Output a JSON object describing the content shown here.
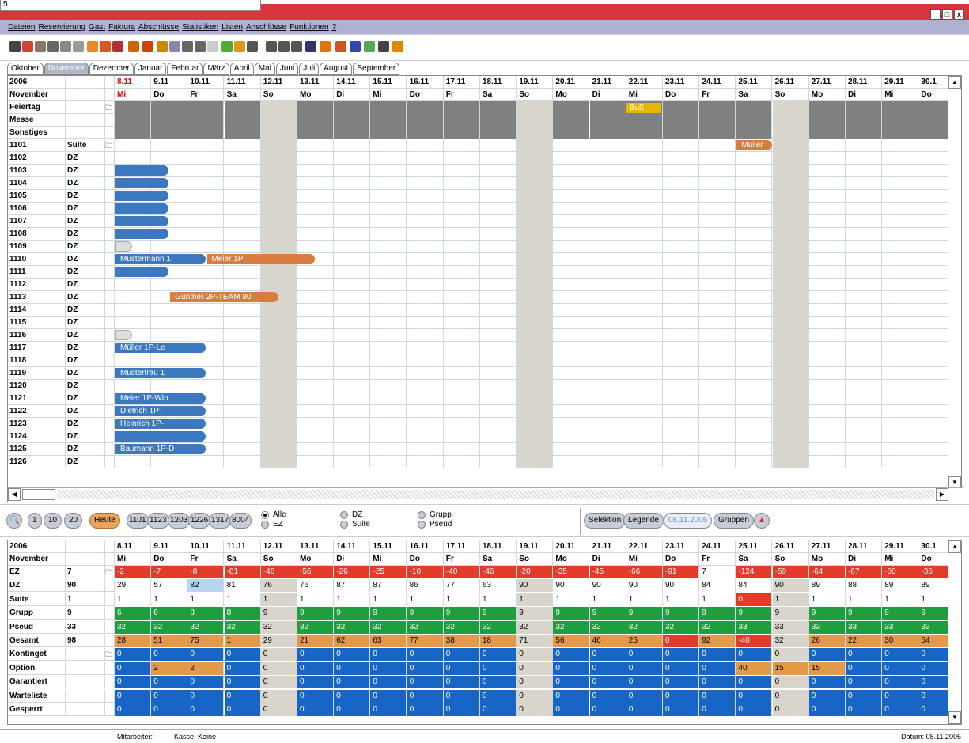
{
  "tooltip": "5",
  "menu": [
    "Dateien",
    "Reservierung",
    "Gast",
    "Faktura",
    "Abschlüsse",
    "Statistiken",
    "Listen",
    "Anschlüsse",
    "Funktionen",
    "?"
  ],
  "window_buttons": [
    "_",
    "□",
    "x"
  ],
  "tabs": [
    "Oktober",
    "November",
    "Dezember",
    "Januar",
    "Februar",
    "März",
    "April",
    "Mai",
    "Juni",
    "Juli",
    "August",
    "September"
  ],
  "active_tab": 1,
  "year": "2006",
  "month": "November",
  "dates": [
    "8.11",
    "9.11",
    "10.11",
    "11.11",
    "12.11",
    "13.11",
    "14.11",
    "15.11",
    "16.11",
    "17.11",
    "18.11",
    "19.11",
    "20.11",
    "21.11",
    "22.11",
    "23.11",
    "24.11",
    "25.11",
    "26.11",
    "27.11",
    "28.11",
    "29.11",
    "30.1"
  ],
  "weekdays": [
    "Mi",
    "Do",
    "Fr",
    "Sa",
    "So",
    "Mo",
    "Di",
    "Mi",
    "Do",
    "Fr",
    "Sa",
    "So",
    "Mo",
    "Di",
    "Mi",
    "Do",
    "Fr",
    "Sa",
    "So",
    "Mo",
    "Di",
    "Mi",
    "Do"
  ],
  "special_rows": [
    "Feiertag",
    "Messe",
    "Sonstiges"
  ],
  "feiertag_label": "Buß",
  "rooms": [
    {
      "no": "1101",
      "type": "Suite"
    },
    {
      "no": "1102",
      "type": "DZ"
    },
    {
      "no": "1103",
      "type": "DZ"
    },
    {
      "no": "1104",
      "type": "DZ"
    },
    {
      "no": "1105",
      "type": "DZ"
    },
    {
      "no": "1106",
      "type": "DZ"
    },
    {
      "no": "1107",
      "type": "DZ"
    },
    {
      "no": "1108",
      "type": "DZ"
    },
    {
      "no": "1109",
      "type": "DZ"
    },
    {
      "no": "1110",
      "type": "DZ"
    },
    {
      "no": "1111",
      "type": "DZ"
    },
    {
      "no": "1112",
      "type": "DZ"
    },
    {
      "no": "1113",
      "type": "DZ"
    },
    {
      "no": "1114",
      "type": "DZ"
    },
    {
      "no": "1115",
      "type": "DZ"
    },
    {
      "no": "1116",
      "type": "DZ"
    },
    {
      "no": "1117",
      "type": "DZ"
    },
    {
      "no": "1118",
      "type": "DZ"
    },
    {
      "no": "1119",
      "type": "DZ"
    },
    {
      "no": "1120",
      "type": "DZ"
    },
    {
      "no": "1121",
      "type": "DZ"
    },
    {
      "no": "1122",
      "type": "DZ"
    },
    {
      "no": "1123",
      "type": "DZ"
    },
    {
      "no": "1124",
      "type": "DZ"
    },
    {
      "no": "1125",
      "type": "DZ"
    },
    {
      "no": "1126",
      "type": "DZ"
    }
  ],
  "bookings": [
    {
      "room": "1101",
      "start": 17,
      "days": 1,
      "label": "Müller",
      "color": "orange"
    },
    {
      "room": "1103",
      "start": 0,
      "days": 1.5,
      "label": "",
      "color": "blue"
    },
    {
      "room": "1104",
      "start": 0,
      "days": 1.5,
      "label": "",
      "color": "blue"
    },
    {
      "room": "1105",
      "start": 0,
      "days": 1.5,
      "label": "",
      "color": "blue"
    },
    {
      "room": "1106",
      "start": 0,
      "days": 1.5,
      "label": "",
      "color": "blue"
    },
    {
      "room": "1107",
      "start": 0,
      "days": 1.5,
      "label": "",
      "color": "blue"
    },
    {
      "room": "1108",
      "start": 0,
      "days": 1.5,
      "label": "",
      "color": "blue"
    },
    {
      "room": "1109",
      "start": 0,
      "days": 0.5,
      "label": "",
      "color": "ghost"
    },
    {
      "room": "1110",
      "start": 0,
      "days": 2.5,
      "label": "Mustermann 1",
      "color": "blue"
    },
    {
      "room": "1110",
      "start": 2.5,
      "days": 3,
      "label": "Meier 1P",
      "color": "orange"
    },
    {
      "room": "1111",
      "start": 0,
      "days": 1.5,
      "label": "",
      "color": "blue"
    },
    {
      "room": "1113",
      "start": 1.5,
      "days": 3,
      "label": "Günther 2P-TEAM 80",
      "color": "orange"
    },
    {
      "room": "1116",
      "start": 0,
      "days": 0.5,
      "label": "",
      "color": "ghost"
    },
    {
      "room": "1117",
      "start": 0,
      "days": 2.5,
      "label": "Müller 1P-Le",
      "color": "blue"
    },
    {
      "room": "1119",
      "start": 0,
      "days": 2.5,
      "label": "Musterfrau 1",
      "color": "blue"
    },
    {
      "room": "1121",
      "start": 0,
      "days": 2.5,
      "label": "Meier 1P-Win",
      "color": "blue"
    },
    {
      "room": "1122",
      "start": 0,
      "days": 2.5,
      "label": "Dietrich 1P-",
      "color": "blue"
    },
    {
      "room": "1123",
      "start": 0,
      "days": 2.5,
      "label": "Heinrich 1P-",
      "color": "blue"
    },
    {
      "room": "1124",
      "start": 0,
      "days": 2.5,
      "label": "",
      "color": "blue"
    },
    {
      "room": "1125",
      "start": 0,
      "days": 2.5,
      "label": "Baumann 1P-D",
      "color": "blue"
    }
  ],
  "controls": {
    "buttons": [
      "1",
      "10",
      "20"
    ],
    "heute": "Heute",
    "rooms": [
      "1101",
      "1123",
      "1203",
      "1226",
      "1317",
      "8004"
    ],
    "filters": [
      "Alle",
      "EZ",
      "DZ",
      "Suite",
      "Grupp",
      "Pseud"
    ],
    "selektion": "Selektion",
    "legende": "Legende",
    "date": "08.11.2006",
    "gruppen": "Gruppen"
  },
  "stats": [
    {
      "label": "EZ",
      "count": "7",
      "values": [
        "-2",
        "-7",
        "-8",
        "-81",
        "-48",
        "-56",
        "-26",
        "-25",
        "-10",
        "-40",
        "-46",
        "-20",
        "-35",
        "-45",
        "-66",
        "-91",
        "7",
        "-124",
        "-59",
        "-64",
        "-67",
        "-60",
        "-36"
      ],
      "colors": [
        "r",
        "r",
        "r",
        "r",
        "r",
        "r",
        "r",
        "r",
        "r",
        "r",
        "r",
        "r",
        "r",
        "r",
        "r",
        "r",
        "w",
        "r",
        "r",
        "r",
        "r",
        "r",
        "r"
      ]
    },
    {
      "label": "DZ",
      "count": "90",
      "values": [
        "29",
        "57",
        "82",
        "81",
        "76",
        "76",
        "87",
        "87",
        "86",
        "77",
        "63",
        "90",
        "90",
        "90",
        "90",
        "90",
        "84",
        "84",
        "90",
        "89",
        "88",
        "89",
        "89"
      ],
      "colors": [
        "w",
        "w",
        "l",
        "w",
        "s",
        "w",
        "w",
        "w",
        "w",
        "w",
        "w",
        "s",
        "w",
        "w",
        "w",
        "w",
        "w",
        "w",
        "s",
        "w",
        "w",
        "w",
        "w"
      ]
    },
    {
      "label": "Suite",
      "count": "1",
      "values": [
        "1",
        "1",
        "1",
        "1",
        "1",
        "1",
        "1",
        "1",
        "1",
        "1",
        "1",
        "1",
        "1",
        "1",
        "1",
        "1",
        "1",
        "0",
        "1",
        "1",
        "1",
        "1",
        "1"
      ],
      "colors": [
        "w",
        "w",
        "w",
        "w",
        "s",
        "w",
        "w",
        "w",
        "w",
        "w",
        "w",
        "s",
        "w",
        "w",
        "w",
        "w",
        "w",
        "r",
        "s",
        "w",
        "w",
        "w",
        "w"
      ]
    },
    {
      "label": "Grupp",
      "count": "9",
      "values": [
        "6",
        "6",
        "8",
        "8",
        "9",
        "9",
        "9",
        "9",
        "9",
        "9",
        "9",
        "9",
        "9",
        "9",
        "9",
        "9",
        "9",
        "9",
        "9",
        "9",
        "9",
        "9",
        "9"
      ],
      "colors": [
        "g",
        "g",
        "g",
        "g",
        "s",
        "g",
        "g",
        "g",
        "g",
        "g",
        "g",
        "s",
        "g",
        "g",
        "g",
        "g",
        "g",
        "g",
        "s",
        "g",
        "g",
        "g",
        "g"
      ]
    },
    {
      "label": "Pseud",
      "count": "33",
      "values": [
        "32",
        "32",
        "32",
        "32",
        "32",
        "32",
        "32",
        "32",
        "32",
        "32",
        "32",
        "32",
        "32",
        "32",
        "32",
        "32",
        "32",
        "33",
        "33",
        "33",
        "33",
        "33",
        "33"
      ],
      "colors": [
        "g",
        "g",
        "g",
        "g",
        "s",
        "g",
        "g",
        "g",
        "g",
        "g",
        "g",
        "s",
        "g",
        "g",
        "g",
        "g",
        "g",
        "g",
        "s",
        "g",
        "g",
        "g",
        "g"
      ]
    },
    {
      "label": "Gesamt",
      "count": "98",
      "values": [
        "28",
        "51",
        "75",
        "1",
        "29",
        "21",
        "62",
        "63",
        "77",
        "38",
        "18",
        "71",
        "56",
        "46",
        "25",
        "0",
        "92",
        "-40",
        "32",
        "26",
        "22",
        "30",
        "54"
      ],
      "colors": [
        "o",
        "o",
        "o",
        "o",
        "s",
        "o",
        "o",
        "o",
        "o",
        "o",
        "o",
        "s",
        "o",
        "o",
        "o",
        "r",
        "o",
        "r",
        "s",
        "o",
        "o",
        "o",
        "o"
      ]
    },
    {
      "label": "Kontinget",
      "count": "",
      "values": [
        "0",
        "0",
        "0",
        "0",
        "0",
        "0",
        "0",
        "0",
        "0",
        "0",
        "0",
        "0",
        "0",
        "0",
        "0",
        "0",
        "0",
        "0",
        "0",
        "0",
        "0",
        "0",
        "0"
      ],
      "colors": [
        "b",
        "b",
        "b",
        "b",
        "s",
        "b",
        "b",
        "b",
        "b",
        "b",
        "b",
        "s",
        "b",
        "b",
        "b",
        "b",
        "b",
        "b",
        "s",
        "b",
        "b",
        "b",
        "b"
      ]
    },
    {
      "label": "Option",
      "count": "",
      "values": [
        "0",
        "2",
        "2",
        "0",
        "0",
        "0",
        "0",
        "0",
        "0",
        "0",
        "0",
        "0",
        "0",
        "0",
        "0",
        "0",
        "0",
        "40",
        "15",
        "15",
        "0",
        "0",
        "0"
      ],
      "colors": [
        "b",
        "o",
        "o",
        "b",
        "s",
        "b",
        "b",
        "b",
        "b",
        "b",
        "b",
        "s",
        "b",
        "b",
        "b",
        "b",
        "b",
        "o",
        "o",
        "o",
        "b",
        "b",
        "b"
      ]
    },
    {
      "label": "Garantiert",
      "count": "",
      "values": [
        "0",
        "0",
        "0",
        "0",
        "0",
        "0",
        "0",
        "0",
        "0",
        "0",
        "0",
        "0",
        "0",
        "0",
        "0",
        "0",
        "0",
        "0",
        "0",
        "0",
        "0",
        "0",
        "0"
      ],
      "colors": [
        "b",
        "b",
        "b",
        "b",
        "s",
        "b",
        "b",
        "b",
        "b",
        "b",
        "b",
        "s",
        "b",
        "b",
        "b",
        "b",
        "b",
        "b",
        "s",
        "b",
        "b",
        "b",
        "b"
      ]
    },
    {
      "label": "Warteliste",
      "count": "",
      "values": [
        "0",
        "0",
        "0",
        "0",
        "0",
        "0",
        "0",
        "0",
        "0",
        "0",
        "0",
        "0",
        "0",
        "0",
        "0",
        "0",
        "0",
        "0",
        "0",
        "0",
        "0",
        "0",
        "0"
      ],
      "colors": [
        "b",
        "b",
        "b",
        "b",
        "s",
        "b",
        "b",
        "b",
        "b",
        "b",
        "b",
        "s",
        "b",
        "b",
        "b",
        "b",
        "b",
        "b",
        "s",
        "b",
        "b",
        "b",
        "b"
      ]
    },
    {
      "label": "Gesperrt",
      "count": "",
      "values": [
        "0",
        "0",
        "0",
        "0",
        "0",
        "0",
        "0",
        "0",
        "0",
        "0",
        "0",
        "0",
        "0",
        "0",
        "0",
        "0",
        "0",
        "0",
        "0",
        "0",
        "0",
        "0",
        "0"
      ],
      "colors": [
        "b",
        "b",
        "b",
        "b",
        "s",
        "b",
        "b",
        "b",
        "b",
        "b",
        "b",
        "s",
        "b",
        "b",
        "b",
        "b",
        "b",
        "b",
        "s",
        "b",
        "b",
        "b",
        "b"
      ]
    }
  ],
  "status": {
    "mitarbeiter": "Mitarbeiter:",
    "kasse": "Kasse: Keine",
    "datum": "Datum: 08.11.2006"
  }
}
